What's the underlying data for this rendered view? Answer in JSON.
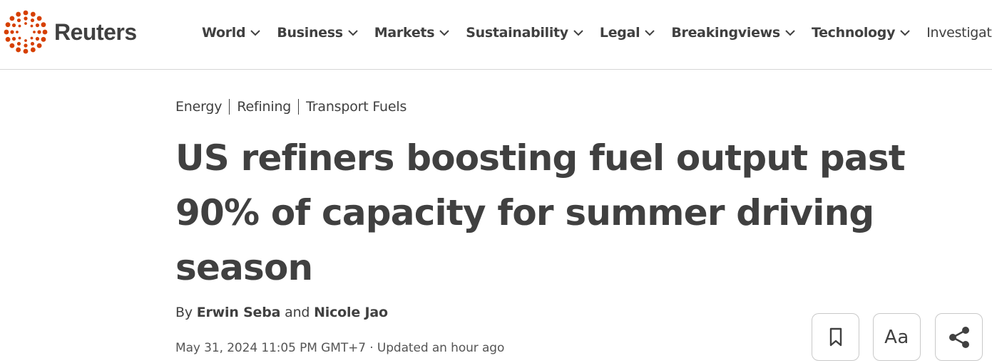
{
  "brand": {
    "name": "Reuters",
    "color": "#d64000"
  },
  "nav": {
    "items": [
      {
        "label": "World"
      },
      {
        "label": "Business"
      },
      {
        "label": "Markets"
      },
      {
        "label": "Sustainability"
      },
      {
        "label": "Legal"
      },
      {
        "label": "Breakingviews"
      },
      {
        "label": "Technology"
      },
      {
        "label": "Investigations"
      }
    ]
  },
  "breadcrumbs": [
    "Energy",
    "Refining",
    "Transport Fuels"
  ],
  "article": {
    "headline": "US refiners boosting fuel output past 90% of capacity for summer driving season",
    "byline_prefix": "By ",
    "author_1": "Erwin Seba",
    "byline_conjunction": " and ",
    "author_2": "Nicole Jao",
    "date": "May 31, 2024 11:05 PM GMT+7",
    "date_separator": " · ",
    "updated": "Updated an hour ago"
  },
  "tools": {
    "bookmark_icon": "bookmark-icon",
    "text_size_label": "Aa",
    "share_icon": "share-icon"
  }
}
